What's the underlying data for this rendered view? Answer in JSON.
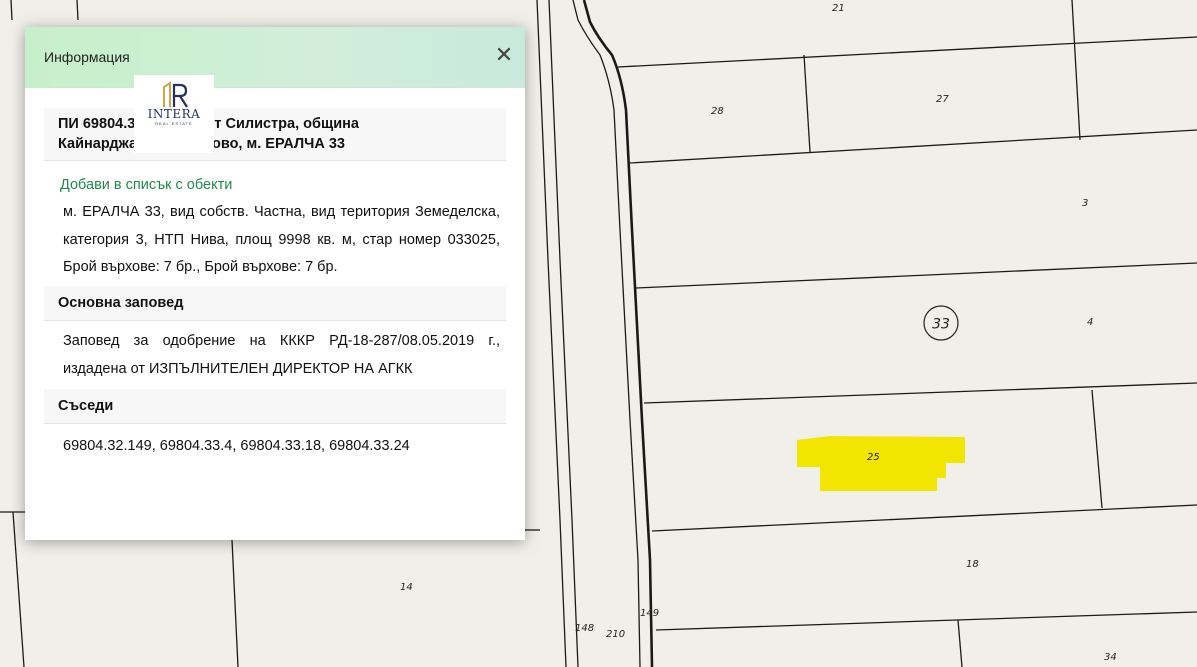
{
  "map": {
    "parcel_labels": [
      "21",
      "28",
      "27",
      "3",
      "4",
      "25",
      "18",
      "14",
      "148",
      "210",
      "149",
      "34"
    ],
    "circle_label": "33",
    "highlight_color": "#f2e600",
    "line_color": "#1a1a1a"
  },
  "popup": {
    "title": "Информация",
    "close_symbol": "✕",
    "logo": {
      "brand": "INTERA",
      "sub": "REAL ESTATE"
    },
    "heading_line1": "ПИ 69804.33.25, област Силистра, община",
    "heading_line2": "Кайнарджа, с. Стрелково, м. ЕРАЛЧА 33",
    "add_link": "Добави в списък с обекти",
    "description": "м. ЕРАЛЧА 33, вид собств. Частна, вид територия Земеделска, категория 3, НТП Нива, площ 9998 кв. м, стар номер 033025, Брой върхове: 7 бр., Брой върхове: 7 бр.",
    "order_title": "Основна заповед",
    "order_text": "Заповед за одобрение на КККР РД-18-287/08.05.2019 г., издадена от ИЗПЪЛНИТЕЛЕН ДИРЕКТОР НА АГКК",
    "neighbors_title": "Съседи",
    "neighbors_text": "69804.32.149, 69804.33.4, 69804.33.18, 69804.33.24"
  }
}
